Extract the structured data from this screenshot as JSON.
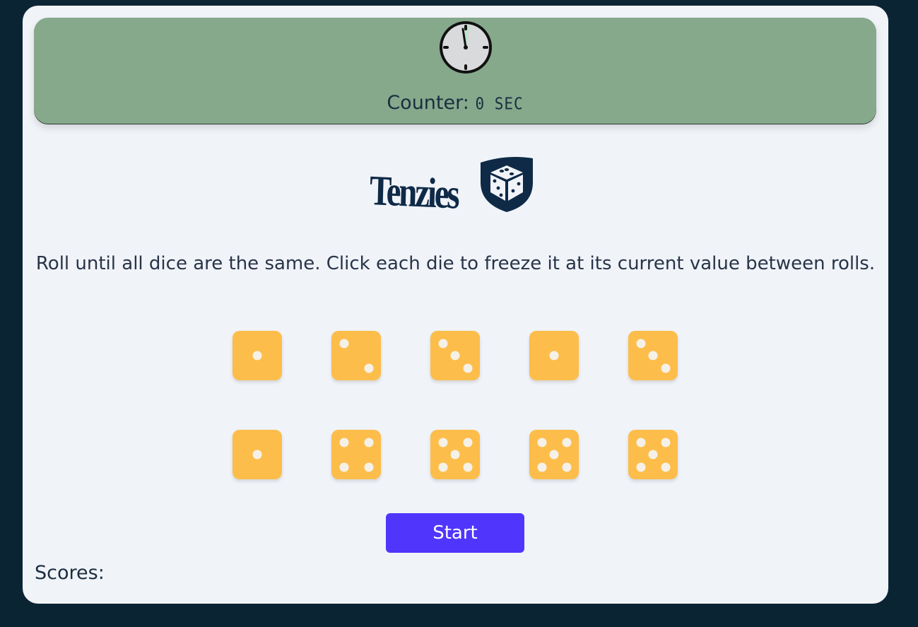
{
  "timer": {
    "label": "Counter:",
    "value": "0 SEC"
  },
  "logo": {
    "text": "Tenzies"
  },
  "instructions": "Roll until all dice are the same. Click each die to freeze it at its current value between rolls.",
  "dice": [
    1,
    2,
    3,
    1,
    3,
    1,
    4,
    5,
    5,
    5
  ],
  "start_button": {
    "label": "Start"
  },
  "scores": {
    "label": "Scores:"
  },
  "colors": {
    "background": "#0b2434",
    "card": "#f0f3f8",
    "timer_bar": "#86a98c",
    "die": "#fdbd4a",
    "pip": "#f5f1e8",
    "button": "#5036fc",
    "text": "#1b2d3f"
  },
  "icons": {
    "clock": "clock-icon",
    "logo_shield": "dice-shield-icon"
  }
}
